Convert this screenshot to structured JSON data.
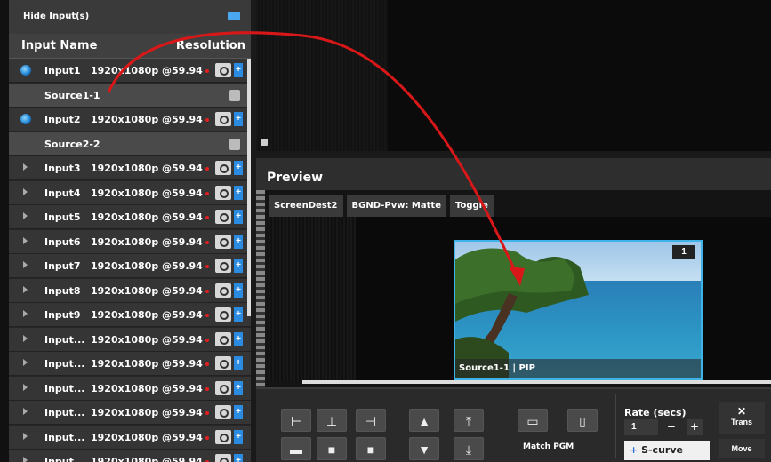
{
  "sidebar": {
    "hide_label": "Hide Input(s)",
    "col_name": "Input Name",
    "col_resolution": "Resolution",
    "rows": [
      {
        "name": "Input1",
        "res": "1920x1080p @59.94",
        "type": "input",
        "live": true
      },
      {
        "name": "Source1-1",
        "type": "source"
      },
      {
        "name": "Input2",
        "res": "1920x1080p @59.94",
        "type": "input",
        "live": true
      },
      {
        "name": "Source2-2",
        "type": "source"
      },
      {
        "name": "Input3",
        "res": "1920x1080p @59.94",
        "type": "input"
      },
      {
        "name": "Input4",
        "res": "1920x1080p @59.94",
        "type": "input"
      },
      {
        "name": "Input5",
        "res": "1920x1080p @59.94",
        "type": "input"
      },
      {
        "name": "Input6",
        "res": "1920x1080p @59.94",
        "type": "input"
      },
      {
        "name": "Input7",
        "res": "1920x1080p @59.94",
        "type": "input"
      },
      {
        "name": "Input8",
        "res": "1920x1080p @59.94",
        "type": "input"
      },
      {
        "name": "Input9",
        "res": "1920x1080p @59.94",
        "type": "input"
      },
      {
        "name": "Input...",
        "res": "1920x1080p @59.94",
        "type": "input"
      },
      {
        "name": "Input...",
        "res": "1920x1080p @59.94",
        "type": "input"
      },
      {
        "name": "Input...",
        "res": "1920x1080p @59.94",
        "type": "input"
      },
      {
        "name": "Input...",
        "res": "1920x1080p @59.94",
        "type": "input"
      },
      {
        "name": "Input...",
        "res": "1920x1080p @59.94",
        "type": "input"
      },
      {
        "name": "Input...",
        "res": "1920x1080p @59.94",
        "type": "input"
      }
    ]
  },
  "preview": {
    "title": "Preview",
    "tabs": [
      "ScreenDest2",
      "BGND-Pvw: Matte",
      "Toggle"
    ],
    "pip_number": "1",
    "pip_label": "Source1-1 | PIP"
  },
  "toolbar": {
    "match_label": "Match PGM",
    "rate_label": "Rate (secs)",
    "rate_value": "1",
    "rate_minus": "−",
    "rate_plus": "+",
    "scurve_plus": "+",
    "scurve_label": "S-curve",
    "trans_label": "Trans",
    "move_label": "Move"
  },
  "colors": {
    "accent": "#3fb3e8",
    "arrow": "#d81818",
    "live": "#1a7fd0"
  },
  "icons": {
    "hide_toggle": "toggle-icon",
    "camera": "camera-icon",
    "add": "plus-icon",
    "copy": "copy-icon",
    "lock": "lock-icon"
  }
}
